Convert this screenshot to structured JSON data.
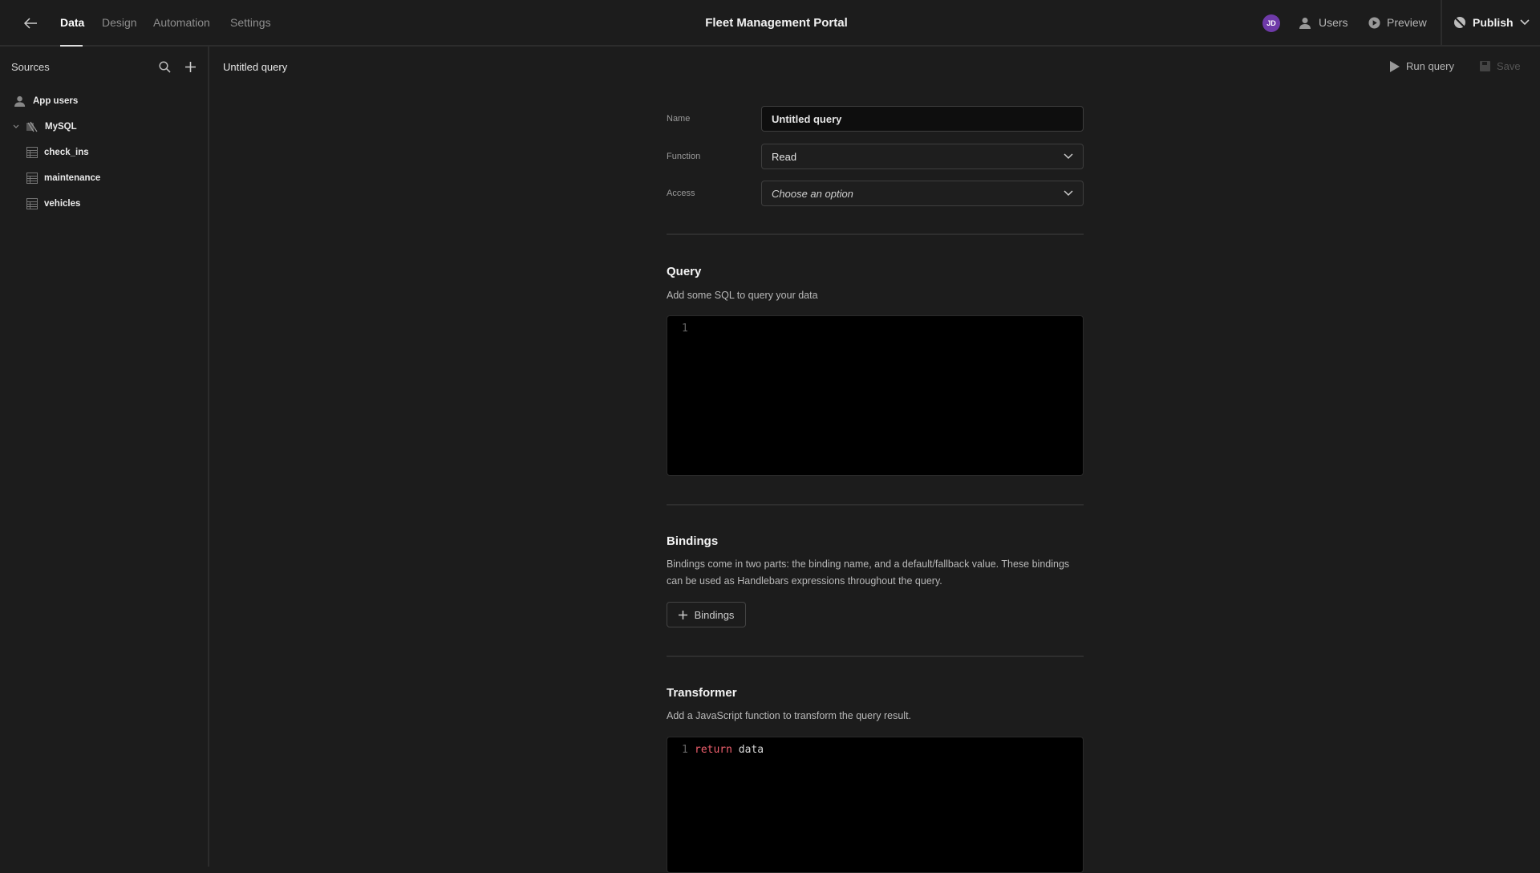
{
  "header": {
    "title": "Fleet Management Portal",
    "tabs": [
      {
        "label": "Data"
      },
      {
        "label": "Design"
      },
      {
        "label": "Automation"
      },
      {
        "label": "Settings"
      }
    ],
    "avatar_initials": "JD",
    "avatar_color": "#6e3aa8",
    "users_label": "Users",
    "preview_label": "Preview",
    "publish_label": "Publish"
  },
  "sidebar": {
    "title": "Sources",
    "items": [
      {
        "label": "App users",
        "icon": "users-icon"
      },
      {
        "label": "MySQL",
        "icon": "mysql-icon"
      },
      {
        "label": "check_ins",
        "icon": "table-icon"
      },
      {
        "label": "maintenance",
        "icon": "table-icon"
      },
      {
        "label": "vehicles",
        "icon": "table-icon"
      }
    ]
  },
  "main": {
    "title": "Untitled query",
    "run_label": "Run query",
    "save_label": "Save",
    "form": {
      "name_label": "Name",
      "name_value": "Untitled query",
      "function_label": "Function",
      "function_value": "Read",
      "access_label": "Access",
      "access_placeholder": "Choose an option"
    },
    "query": {
      "heading": "Query",
      "description": "Add some SQL to query your data",
      "line_number": "1"
    },
    "bindings": {
      "heading": "Bindings",
      "description": "Bindings come in two parts: the binding name, and a default/fallback value. These bindings can be used as Handlebars expressions throughout the query.",
      "button_label": "Bindings"
    },
    "transformer": {
      "heading": "Transformer",
      "description": "Add a JavaScript function to transform the query result.",
      "line_number": "1",
      "keyword": "return",
      "code_rest": " data",
      "keyword_color": "#f0606e"
    }
  }
}
